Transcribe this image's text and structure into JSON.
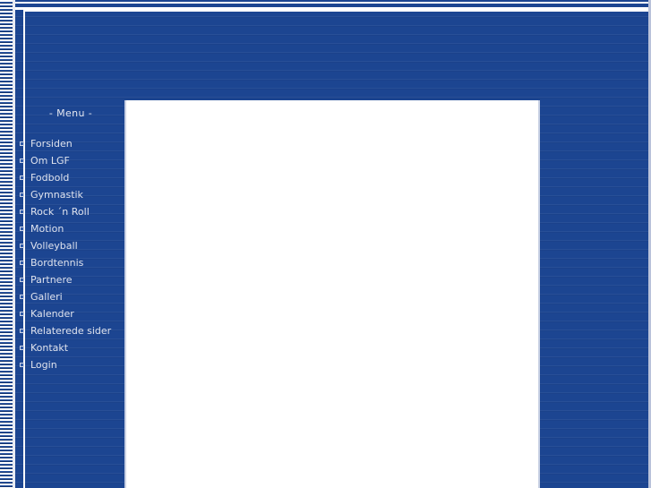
{
  "site": {
    "background_color": "#1c4591",
    "text_color": "#dfe3ee",
    "panel_color": "#ffffff",
    "accent_color": "#ffffff"
  },
  "banner": {
    "alt": "header-banner"
  },
  "sidebar": {
    "title": "- Menu -",
    "items": [
      {
        "label": "Forsiden"
      },
      {
        "label": "Om LGF"
      },
      {
        "label": "Fodbold"
      },
      {
        "label": "Gymnastik"
      },
      {
        "label": "Rock ´n Roll"
      },
      {
        "label": "Motion"
      },
      {
        "label": "Volleyball"
      },
      {
        "label": "Bordtennis"
      },
      {
        "label": "Partnere"
      },
      {
        "label": "Galleri"
      },
      {
        "label": "Kalender"
      },
      {
        "label": "Relaterede sider"
      },
      {
        "label": "Kontakt"
      },
      {
        "label": "Login"
      }
    ]
  },
  "content": {
    "body_text": ""
  }
}
